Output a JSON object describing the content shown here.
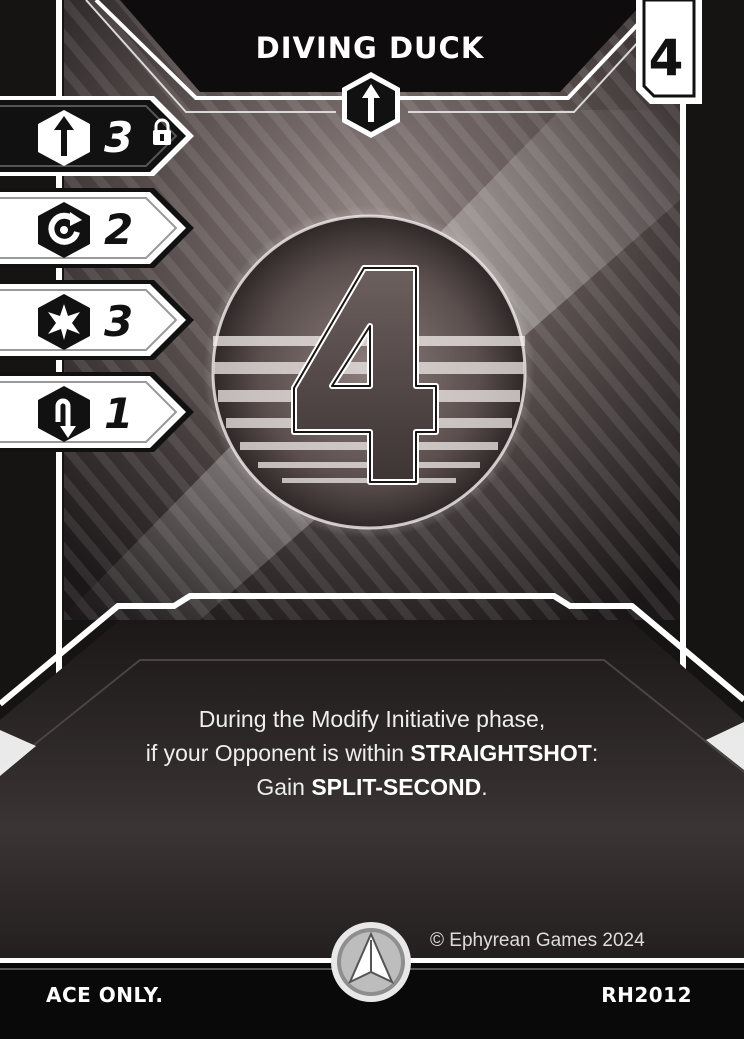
{
  "card": {
    "title": "DIVING DUCK",
    "corner_value": "4",
    "center_value": "4",
    "top_icon": "arrow-up-hex-icon",
    "stats": [
      {
        "icon": "arrow-up-hex-icon",
        "value": "3",
        "locked": true,
        "lock_icon": "lock-icon"
      },
      {
        "icon": "rotate-hex-icon",
        "value": "2"
      },
      {
        "icon": "burst-hex-icon",
        "value": "3"
      },
      {
        "icon": "arrow-down-hex-icon",
        "value": "1"
      }
    ],
    "ability": {
      "line1": "During the Modify Initiative phase,",
      "line2_pre": "if your Opponent is within ",
      "line2_bold": "STRAIGHTSHOT",
      "line2_post": ":",
      "line3_pre": "Gain ",
      "line3_bold": "SPLIT-SECOND",
      "line3_post": "."
    },
    "copyright": "© Ephyrean Games 2024",
    "footer_left": "ACE ONLY.",
    "footer_right": "RH2012",
    "faction_icon": "delta-emblem-icon"
  }
}
